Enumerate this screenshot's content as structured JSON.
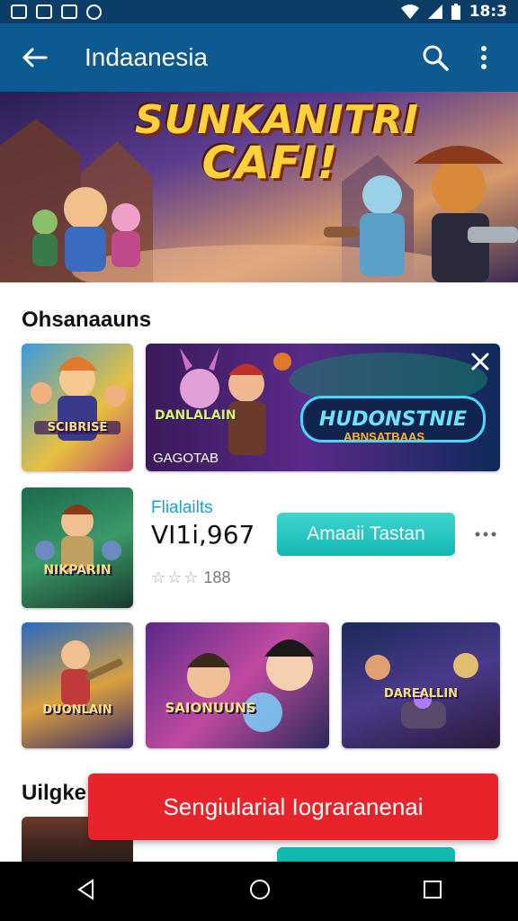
{
  "status_bar": {
    "time": "18:3"
  },
  "app_bar": {
    "title": "Indaanesia",
    "back_icon": "arrow-left-icon",
    "search_icon": "search-icon",
    "menu_icon": "more-vertical-icon"
  },
  "hero": {
    "title_line1": "SUNKANITRI",
    "title_line2": "CAFI!"
  },
  "section1": {
    "title": "Ohsanaauns",
    "tile1_label": "SCIBRISE",
    "featured": {
      "logo_text": "HUDONSTNIE",
      "sub_text": "ABNSATBAAS",
      "caption": "GAGOTAB",
      "left_text": "DANLALAIN"
    }
  },
  "row_item": {
    "tile_label": "NIKPARIN",
    "name": "Flialailts",
    "price": "VI1i,967",
    "rating_text": "188",
    "install_label": "Amaaii Tastan"
  },
  "grid": [
    {
      "label": "DUONLAIN"
    },
    {
      "label": "SAIONUUNS"
    },
    {
      "label": "DAREALLIN"
    }
  ],
  "section2": {
    "title": "Uilgke"
  },
  "toast": {
    "text": "Sengiularial Iograranenai"
  },
  "colors": {
    "app_bar": "#0d5a93",
    "status_bar": "#0b3d66",
    "accent": "#12b7b0",
    "banner": "#e8232a"
  }
}
